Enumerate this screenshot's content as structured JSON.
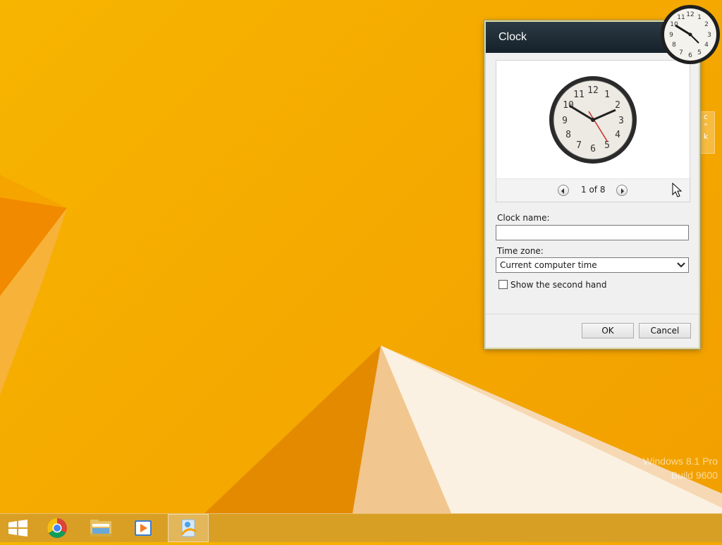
{
  "os": {
    "watermark_line1": "Windows 8.1 Pro",
    "watermark_line2": "Build 9600"
  },
  "gadget_stub": {
    "text": "c\n°\nk"
  },
  "dialog": {
    "title": "Clock",
    "pager_text": "1 of 8",
    "clock_name_label": "Clock name:",
    "clock_name_value": "",
    "time_zone_label": "Time zone:",
    "time_zone_value": "Current computer time",
    "second_hand_label": "Show the second hand",
    "second_hand_checked": false,
    "ok_label": "OK",
    "cancel_label": "Cancel"
  },
  "taskbar": {
    "items": [
      {
        "name": "start-button",
        "icon": "windows-logo-icon"
      },
      {
        "name": "chrome",
        "icon": "chrome-icon"
      },
      {
        "name": "file-explorer",
        "icon": "folder-icon"
      },
      {
        "name": "media-player",
        "icon": "media-player-icon"
      },
      {
        "name": "desktop-gadgets",
        "icon": "gadgets-icon"
      }
    ]
  },
  "colors": {
    "wallpaper": "#f5ab00",
    "title_bar": "#15212a",
    "taskbar": "#d69e28"
  }
}
